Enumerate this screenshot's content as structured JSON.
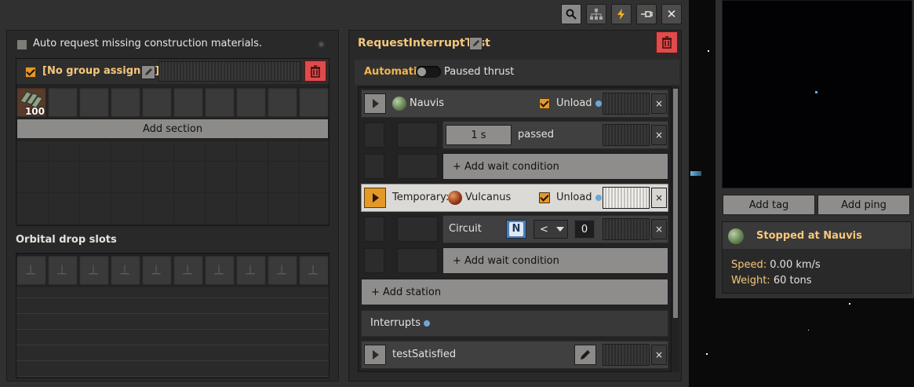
{
  "toolbar": {
    "close_symbol": "✕"
  },
  "left_panel": {
    "auto_request_label": "Auto request missing construction materials.",
    "group": {
      "label": "[No group assigned]"
    },
    "slot_item": {
      "count": "100",
      "icon": "steel-plate-icon"
    },
    "add_section_label": "Add section",
    "orbital_label": "Orbital drop slots"
  },
  "schedule": {
    "title": "RequestInterruptTest",
    "automatic_label": "Automatic",
    "paused_label": "Paused thrust",
    "station1": {
      "name": "Nauvis",
      "unload_label": "Unload"
    },
    "cond1": {
      "value": "1 s",
      "text": "passed"
    },
    "add_wait_label": "+ Add wait condition",
    "station2": {
      "prefix": "Temporary:",
      "name": "Vulcanus",
      "unload_label": "Unload"
    },
    "cond2": {
      "type": "Circuit",
      "signal": "N",
      "op": "<",
      "value": "0"
    },
    "add_wait_label_2": "+ Add wait condition",
    "add_station_label": "+ Add station",
    "interrupts_label": "Interrupts",
    "interrupt1": {
      "name": "testSatisfied"
    },
    "close_x": "×"
  },
  "right_panel": {
    "add_tag_label": "Add tag",
    "add_ping_label": "Add ping",
    "status": "Stopped at Nauvis",
    "speed_label": "Speed:",
    "speed_value": "0.00 km/s",
    "weight_label": "Weight:",
    "weight_value": "60 tons"
  },
  "colors": {
    "accent": "#e39827",
    "danger": "#e04b4b",
    "title_gold": "#f5c87a"
  }
}
